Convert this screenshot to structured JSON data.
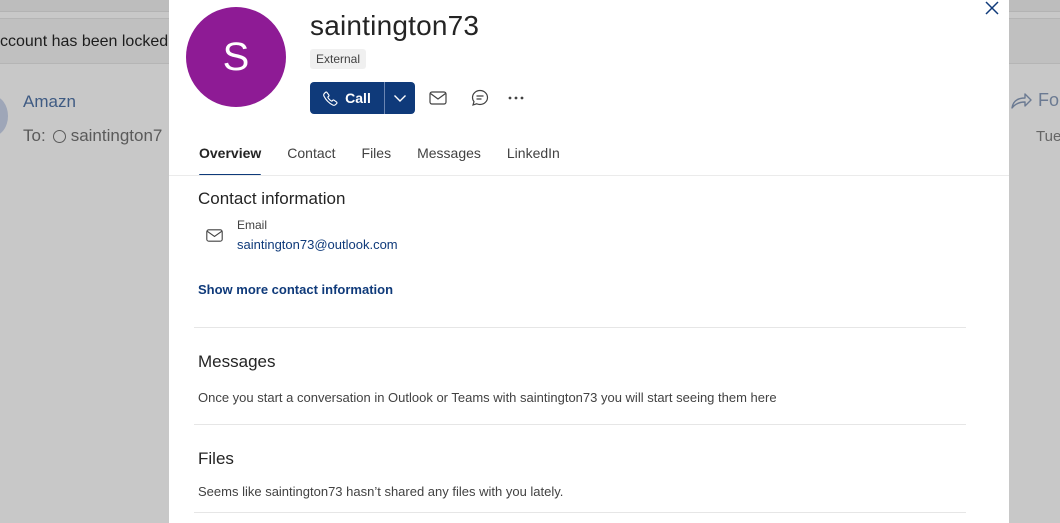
{
  "background": {
    "banner_text": "ccount has been locked",
    "sender": "Amazn",
    "to_label": "To:",
    "to_recipient": "saintington7",
    "forward_label": "Fo",
    "date": "Tue"
  },
  "card": {
    "avatar_initial": "S",
    "avatar_color": "#8e1b95",
    "name": "saintington73",
    "badge": "External",
    "actions": {
      "call_label": "Call",
      "call_icon": "phone-icon",
      "split_icon": "chevron-down-icon",
      "email_icon": "mail-icon",
      "chat_icon": "chat-icon",
      "more_icon": "more-horizontal-icon"
    },
    "tabs": [
      {
        "label": "Overview",
        "active": true
      },
      {
        "label": "Contact",
        "active": false
      },
      {
        "label": "Files",
        "active": false
      },
      {
        "label": "Messages",
        "active": false
      },
      {
        "label": "LinkedIn",
        "active": false
      }
    ],
    "contact_section": {
      "title": "Contact information",
      "email_label": "Email",
      "email_value": "saintington73@outlook.com",
      "show_more": "Show more contact information"
    },
    "messages_section": {
      "title": "Messages",
      "text": "Once you start a conversation in Outlook or Teams with saintington73 you will start seeing them here"
    },
    "files_section": {
      "title": "Files",
      "text": "Seems like saintington73 hasn’t shared any files with you lately."
    }
  },
  "colors": {
    "accent": "#0f3a7a",
    "overlay": "#c8c8c8"
  }
}
